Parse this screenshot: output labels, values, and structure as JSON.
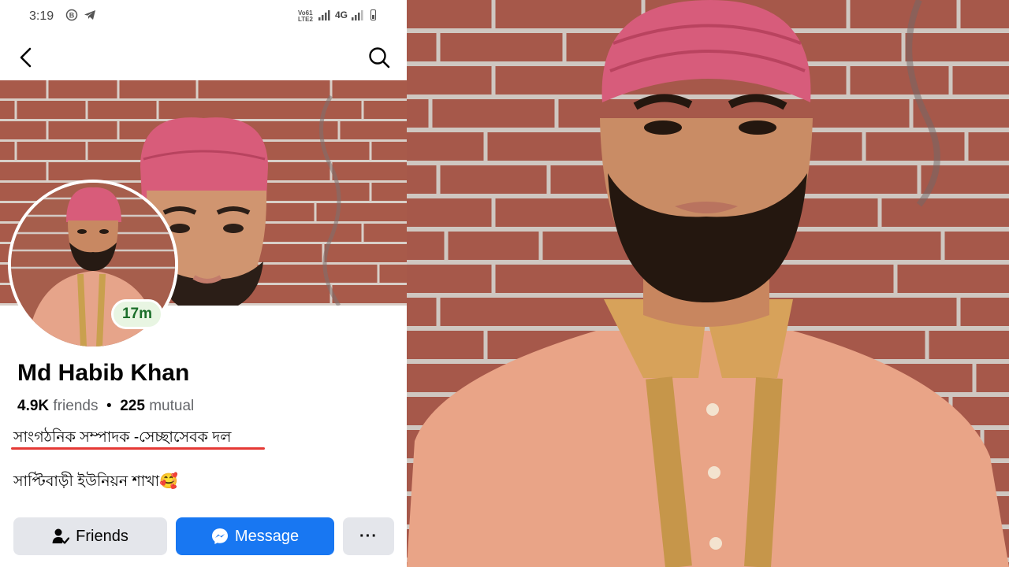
{
  "status_bar": {
    "time": "3:19",
    "network_top": "Vo61",
    "network_bottom": "LTE2",
    "network_type": "4G"
  },
  "nav": {
    "back_icon": "chevron-left-icon",
    "search_icon": "search-icon"
  },
  "profile": {
    "name": "Md Habib Khan",
    "friends_count": "4.9K",
    "friends_label": "friends",
    "separator": "•",
    "mutual_count": "225",
    "mutual_label": "mutual",
    "bio_line1": "সাংগঠনিক সম্পাদক -সেচ্ছাসেবক দল",
    "bio_line2": "সাপ্টিবাড়ী ইউনিয়ন শাখা🥰",
    "story_badge": "17m"
  },
  "actions": {
    "friends_label": "Friends",
    "message_label": "Message",
    "more_label": "···"
  },
  "colors": {
    "accent": "#1877f2",
    "underline": "#e53935",
    "badge_text": "#1b6e2a"
  }
}
